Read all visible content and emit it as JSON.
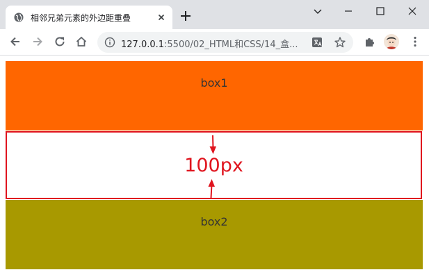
{
  "browser": {
    "tab_title": "相邻兄弟元素的外边距重叠",
    "url_host": "127.0.0.1",
    "url_path": ":5500/02_HTML和CSS/14_盒..."
  },
  "page": {
    "box1_label": "box1",
    "box2_label": "box2",
    "gap_label": "100px"
  },
  "colors": {
    "box1": "#ff6600",
    "box2": "#a89900",
    "annotation": "#e0141e"
  }
}
